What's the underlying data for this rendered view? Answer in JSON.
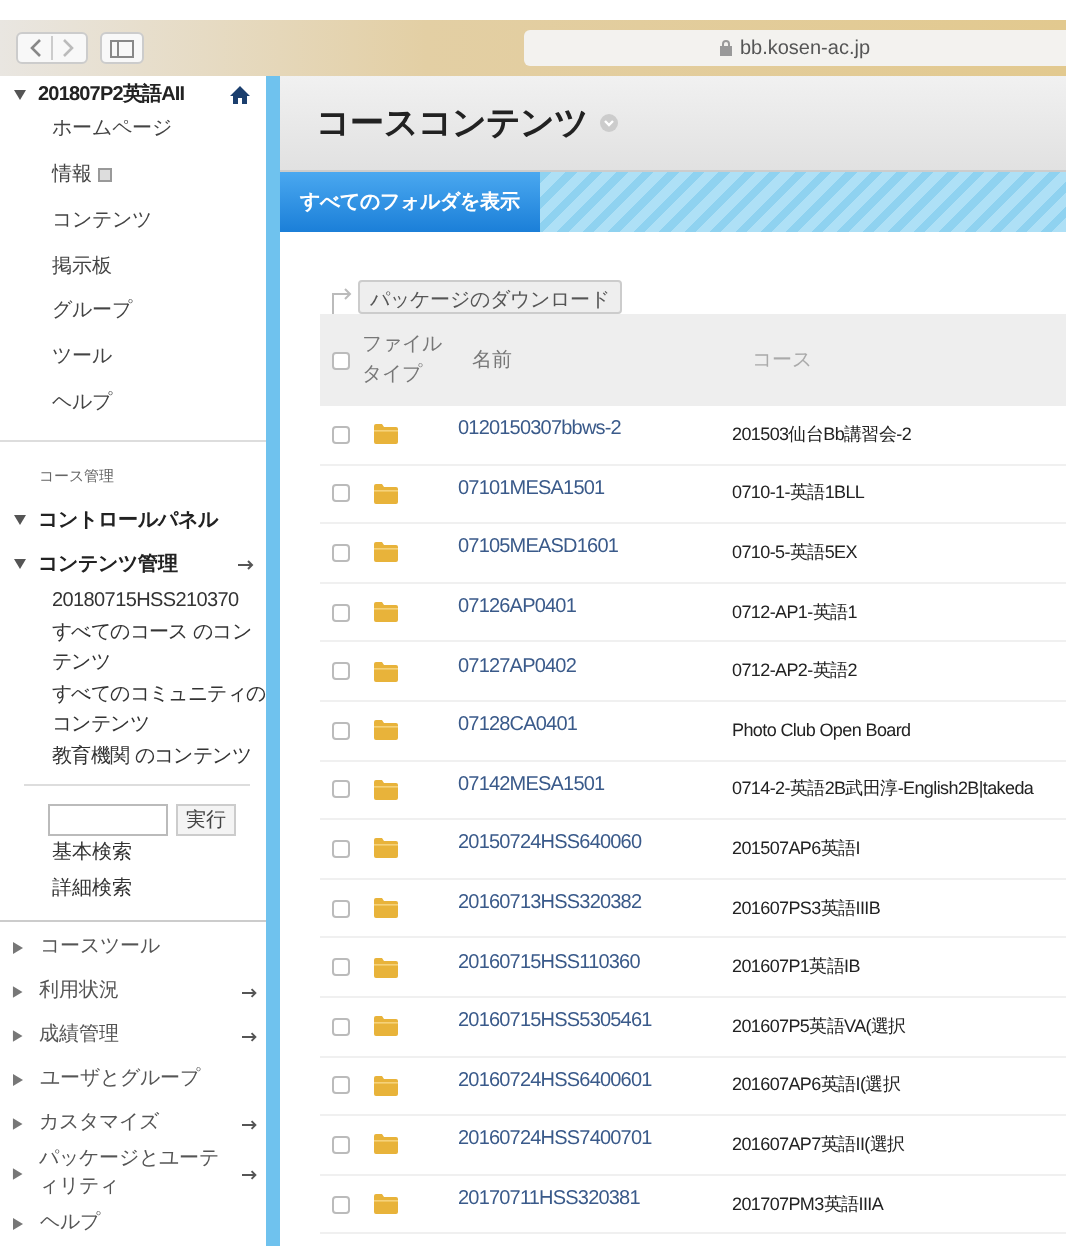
{
  "browser": {
    "address": "bb.kosen-ac.jp"
  },
  "sidebar": {
    "course_title": "201807P2英語AII",
    "menu_items": [
      {
        "label": "ホームページ"
      },
      {
        "label": "情報",
        "badge": true
      },
      {
        "label": "コンテンツ"
      },
      {
        "label": "掲示板"
      },
      {
        "label": "グループ"
      },
      {
        "label": "ツール"
      },
      {
        "label": "ヘルプ"
      }
    ],
    "section_label": "コース管理",
    "panels": [
      {
        "label": "コントロールパネル",
        "expanded": true,
        "arrow": false
      },
      {
        "label": "コンテンツ管理",
        "expanded": true,
        "arrow": true,
        "children": [
          "20180715HSS210370",
          "すべてのコース のコンテンツ",
          "すべてのコミュニティのコンテンツ",
          "教育機関 のコンテンツ"
        ]
      }
    ],
    "search": {
      "button": "実行"
    },
    "search_links": [
      "基本検索",
      "詳細検索"
    ],
    "tools": [
      {
        "label": "コースツール",
        "expanded": false,
        "arrow": false
      },
      {
        "label": "利用状況",
        "expanded": false,
        "arrow": true
      },
      {
        "label": "成績管理",
        "expanded": false,
        "arrow": true
      },
      {
        "label": "ユーザとグループ",
        "expanded": false,
        "arrow": false
      },
      {
        "label": "カスタマイズ",
        "expanded": false,
        "arrow": true
      },
      {
        "label": "パッケージとユーティリティ",
        "expanded": false,
        "arrow": true
      },
      {
        "label": "ヘルプ",
        "expanded": false,
        "arrow": false
      }
    ]
  },
  "page": {
    "title": "コースコンテンツ",
    "tabs": [
      {
        "label": "すべてのフォルダを表示",
        "selected": true
      }
    ],
    "download_button": "パッケージのダウンロード"
  },
  "table": {
    "select_all_checked": false,
    "columns": [
      "ファイルタイプ",
      "名前",
      "コース"
    ],
    "rows": [
      {
        "checked": false,
        "name": "0120150307bbws-2",
        "course": "201503仙台Bb講習会-2"
      },
      {
        "checked": false,
        "name": "07101MESA1501",
        "course": "0710-1-英語1BLL"
      },
      {
        "checked": false,
        "name": "07105MEASD1601",
        "course": "0710-5-英語5EX"
      },
      {
        "checked": false,
        "name": "07126AP0401",
        "course": "0712-AP1-英語1"
      },
      {
        "checked": false,
        "name": "07127AP0402",
        "course": "0712-AP2-英語2"
      },
      {
        "checked": false,
        "name": "07128CA0401",
        "course": "Photo Club Open Board"
      },
      {
        "checked": false,
        "name": "07142MESA1501",
        "course": "0714-2-英語2B武田淳-English2B|takeda"
      },
      {
        "checked": false,
        "name": "20150724HSS640060",
        "course": "201507AP6英語I"
      },
      {
        "checked": false,
        "name": "20160713HSS320382",
        "course": "201607PS3英語IIIB"
      },
      {
        "checked": false,
        "name": "20160715HSS110360",
        "course": "201607P1英語IB"
      },
      {
        "checked": false,
        "name": "20160715HSS5305461",
        "course": "201607P5英語VA(選択"
      },
      {
        "checked": false,
        "name": "20160724HSS6400601",
        "course": "201607AP6英語I(選択"
      },
      {
        "checked": false,
        "name": "20160724HSS7400701",
        "course": "201607AP7英語II(選択"
      },
      {
        "checked": false,
        "name": "20170711HSS320381",
        "course": "201707PM3英語IIIA"
      }
    ]
  }
}
